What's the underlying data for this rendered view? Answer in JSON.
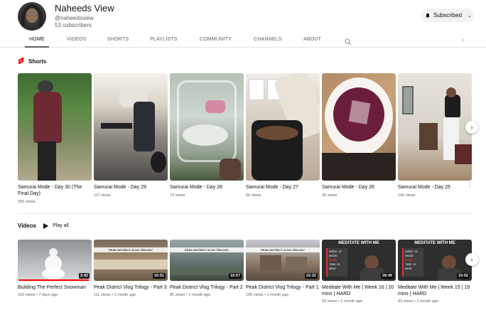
{
  "channel": {
    "name": "Naheeds View",
    "handle": "@naheedsview",
    "subscribers": "53 subscribers",
    "subscribe_label": "Subscribed"
  },
  "tabs": [
    "HOME",
    "VIDEOS",
    "SHORTS",
    "PLAYLISTS",
    "COMMUNITY",
    "CHANNELS",
    "ABOUT"
  ],
  "active_tab": "HOME",
  "shorts_section": {
    "title": "Shorts",
    "items": [
      {
        "title": "Samurai Mode - Day 30 (The Final Day)",
        "views": "390 views"
      },
      {
        "title": "Samurai Mode - Day 29",
        "views": "117 views"
      },
      {
        "title": "Samurai Mode - Day 28",
        "views": "73 views"
      },
      {
        "title": "Samurai Mode - Day 27",
        "views": "66 views"
      },
      {
        "title": "Samurai Mode - Day 26",
        "views": "36 views"
      },
      {
        "title": "Samurai Mode - Day 25",
        "views": "140 views"
      }
    ]
  },
  "videos_section": {
    "title": "Videos",
    "play_all_label": "Play all",
    "items": [
      {
        "title": "Building The Perfect Snowman",
        "meta": "102 views • 7 days ago",
        "duration": "2:42"
      },
      {
        "title": "Peak District Vlog Trilogy - Part 3",
        "meta": "111 views • 1 month ago",
        "duration": "16:51"
      },
      {
        "title": "Peak District Vlog Trilogy - Part 2",
        "meta": "85 views • 1 month ago",
        "duration": "16:57"
      },
      {
        "title": "Peak District Vlog Trilogy - Part 1",
        "meta": "195 views • 1 month ago",
        "duration": "22:32"
      },
      {
        "title": "Meditate With Me | Week 16 | 20 mins | HARD",
        "meta": "63 views • 1 month ago",
        "duration": "28:49"
      },
      {
        "title": "Meditate With Me | Week 15 | 19 mins | HARD",
        "meta": "43 views • 1 month ago",
        "duration": "19:52"
      }
    ],
    "thumb_text": {
      "vlog_banner": "PEAK DISTRICT VLOG TRILOGY",
      "meditate": "MEDITATE WITH ME",
      "week16": "WEEK: 16",
      "week15": "WEEK: 15",
      "mode_label": "MODE:",
      "mode_value": "HARD",
      "time16": "TIME: 20 MINS",
      "time15": "TIME: 19 MINS"
    }
  },
  "colors": {
    "accent_red": "#ff0000",
    "text_primary": "#0f0f0f",
    "text_secondary": "#606060"
  }
}
